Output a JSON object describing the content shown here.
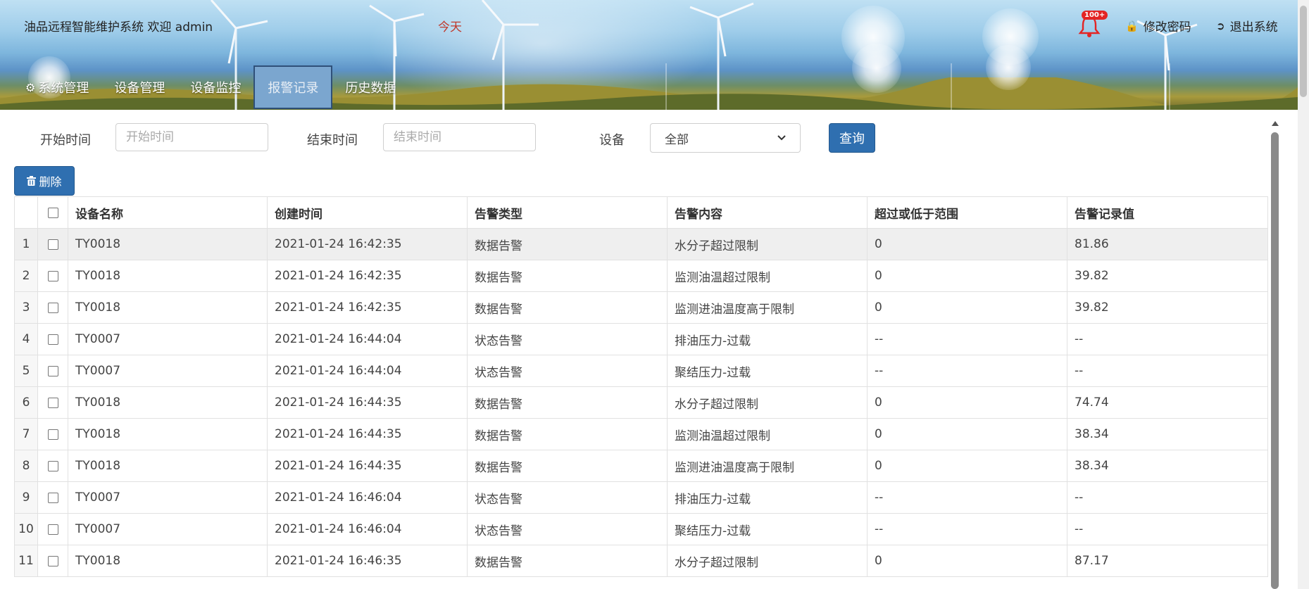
{
  "header": {
    "title": "油品远程智能维护系统 欢迎 admin",
    "today": "今天",
    "notification_badge": "100+",
    "change_password": "修改密码",
    "logout": "退出系统"
  },
  "nav": {
    "items": [
      {
        "label": "系统管理"
      },
      {
        "label": "设备管理"
      },
      {
        "label": "设备监控"
      },
      {
        "label": "报警记录"
      },
      {
        "label": "历史数据"
      }
    ],
    "active": "报警记录"
  },
  "filter": {
    "start_label": "开始时间",
    "start_placeholder": "开始时间",
    "end_label": "结束时间",
    "end_placeholder": "结束时间",
    "device_label": "设备",
    "device_selected": "全部",
    "query_button": "查询"
  },
  "actions": {
    "delete_button": "删除"
  },
  "table": {
    "headers": [
      "设备名称",
      "创建时间",
      "告警类型",
      "告警内容",
      "超过或低于范围",
      "告警记录值"
    ],
    "rows": [
      {
        "no": "1",
        "device": "TY0018",
        "time": "2021-01-24 16:42:35",
        "type": "数据告警",
        "content": "水分子超过限制",
        "range": "0",
        "value": "81.86"
      },
      {
        "no": "2",
        "device": "TY0018",
        "time": "2021-01-24 16:42:35",
        "type": "数据告警",
        "content": "监测油温超过限制",
        "range": "0",
        "value": "39.82"
      },
      {
        "no": "3",
        "device": "TY0018",
        "time": "2021-01-24 16:42:35",
        "type": "数据告警",
        "content": "监测进油温度高于限制",
        "range": "0",
        "value": "39.82"
      },
      {
        "no": "4",
        "device": "TY0007",
        "time": "2021-01-24 16:44:04",
        "type": "状态告警",
        "content": "排油压力-过载",
        "range": "--",
        "value": "--"
      },
      {
        "no": "5",
        "device": "TY0007",
        "time": "2021-01-24 16:44:04",
        "type": "状态告警",
        "content": "聚结压力-过载",
        "range": "--",
        "value": "--"
      },
      {
        "no": "6",
        "device": "TY0018",
        "time": "2021-01-24 16:44:35",
        "type": "数据告警",
        "content": "水分子超过限制",
        "range": "0",
        "value": "74.74"
      },
      {
        "no": "7",
        "device": "TY0018",
        "time": "2021-01-24 16:44:35",
        "type": "数据告警",
        "content": "监测油温超过限制",
        "range": "0",
        "value": "38.34"
      },
      {
        "no": "8",
        "device": "TY0018",
        "time": "2021-01-24 16:44:35",
        "type": "数据告警",
        "content": "监测进油温度高于限制",
        "range": "0",
        "value": "38.34"
      },
      {
        "no": "9",
        "device": "TY0007",
        "time": "2021-01-24 16:46:04",
        "type": "状态告警",
        "content": "排油压力-过载",
        "range": "--",
        "value": "--"
      },
      {
        "no": "10",
        "device": "TY0007",
        "time": "2021-01-24 16:46:04",
        "type": "状态告警",
        "content": "聚结压力-过载",
        "range": "--",
        "value": "--"
      },
      {
        "no": "11",
        "device": "TY0018",
        "time": "2021-01-24 16:46:35",
        "type": "数据告警",
        "content": "水分子超过限制",
        "range": "0",
        "value": "87.17"
      }
    ]
  },
  "icons": {
    "gear": "gear-icon",
    "bell": "bell-icon",
    "lock": "lock-icon",
    "logout": "logout-icon",
    "trash": "trash-icon",
    "dropdown": "chevron-down-icon"
  },
  "colors": {
    "primary_button": "#2f6fb0",
    "active_nav": "#7ba6cf",
    "today_text": "#c0392b",
    "badge": "#e32424"
  }
}
